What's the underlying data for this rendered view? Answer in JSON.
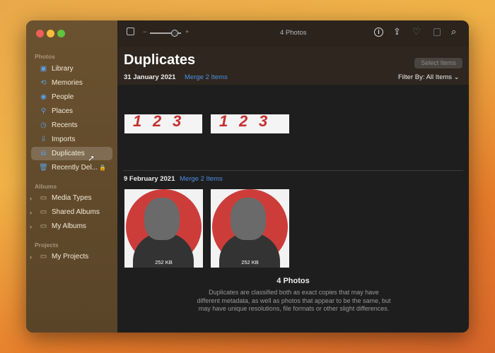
{
  "toolbar": {
    "title": "4 Photos",
    "zoom_minus": "−",
    "zoom_plus": "+"
  },
  "sidebar": {
    "photos_header": "Photos",
    "items": [
      {
        "label": "Library"
      },
      {
        "label": "Memories"
      },
      {
        "label": "People"
      },
      {
        "label": "Places"
      },
      {
        "label": "Recents"
      },
      {
        "label": "Imports"
      },
      {
        "label": "Duplicates"
      },
      {
        "label": "Recently Del..."
      }
    ],
    "albums_header": "Albums",
    "albums": [
      {
        "label": "Media Types"
      },
      {
        "label": "Shared Albums"
      },
      {
        "label": "My Albums"
      }
    ],
    "projects_header": "Projects",
    "projects": [
      {
        "label": "My Projects"
      }
    ]
  },
  "header": {
    "title": "Duplicates",
    "select_items": "Select Items",
    "filter": "Filter By: All Items"
  },
  "groups": [
    {
      "date": "31 January 2021",
      "merge": "Merge 2 Items",
      "nums": [
        "1",
        "2",
        "3"
      ]
    },
    {
      "date": "9 February 2021",
      "merge": "Merge 2 Items",
      "sizes": [
        "252 KB",
        "252 KB"
      ]
    }
  ],
  "footer": {
    "count": "4 Photos",
    "description": "Duplicates are classified both as exact copies that may have different metadata, as well as photos that appear to be the same, but may have unique resolutions, file formats or other slight differences."
  },
  "colors": {
    "accent": "#4d8fe0",
    "selection": "#7a6446"
  }
}
